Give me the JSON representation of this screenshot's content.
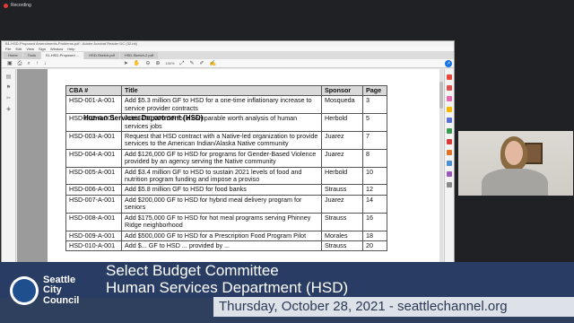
{
  "recording": {
    "label": "Recording"
  },
  "window": {
    "titlebar_text": "B1-HSD-Proposed Amendments-Problems.pdf - Adobe Acrobat Reader DC (32-bit)",
    "menu": [
      "File",
      "Edit",
      "View",
      "Sign",
      "Window",
      "Help"
    ],
    "tabs": [
      "Home",
      "Tools",
      "01-HSD-Proposed ...",
      "HSD-Sketch.pdf",
      "HSD-Sketch-2.pdf"
    ],
    "toolbar_icons": [
      "save-icon",
      "print-icon",
      "search-icon",
      "prev-page-icon",
      "next-page-icon",
      "select-icon",
      "hand-icon",
      "zoom-out-icon",
      "zoom-in-icon",
      "zoom-level",
      "fit-icon",
      "comment-icon",
      "highlight-icon",
      "sign-icon"
    ],
    "zoom": "150%"
  },
  "document": {
    "heading": "Human Services Department (HSD)",
    "table": {
      "headers": [
        "CBA #",
        "Title",
        "Sponsor",
        "Page"
      ],
      "rows": [
        [
          "HSD-001-A-001",
          "Add $5.3 million GF to HSD for a one-time inflationary increase to service provider contracts",
          "Mosqueda",
          "3"
        ],
        [
          "HSD-002-A-001",
          "Add $750,000 GF for a comparable worth analysis of human services jobs",
          "Herbold",
          "5"
        ],
        [
          "HSD-003-A-001",
          "Request that HSD contract with a Native-led organization to provide services to the American Indian/Alaska Native community",
          "Juarez",
          "7"
        ],
        [
          "HSD-004-A-001",
          "Add $126,000 GF to HSD for programs for Gender-Based Violence provided by an agency serving the Native community",
          "Juarez",
          "8"
        ],
        [
          "HSD-005-A-001",
          "Add $3.4 million GF to HSD to sustain 2021 levels of food and nutrition program funding and impose a proviso",
          "Herbold",
          "10"
        ],
        [
          "HSD-006-A-001",
          "Add $5.8 million GF to HSD for food banks",
          "Strauss",
          "12"
        ],
        [
          "HSD-007-A-001",
          "Add $200,000 GF to HSD for hybrid meal delivery program for seniors",
          "Juarez",
          "14"
        ],
        [
          "HSD-008-A-001",
          "Add $175,000 GF to HSD for hot meal programs serving Phinney Ridge neighborhood",
          "Strauss",
          "16"
        ],
        [
          "HSD-009-A-001",
          "Add $500,000 GF to HSD for a Prescription Food Program Pilot",
          "Morales",
          "18"
        ],
        [
          "HSD-010-A-001",
          "Add $... GF to HSD ... provided by ...",
          "Strauss",
          "20"
        ]
      ]
    }
  },
  "lower_third": {
    "logo_lines": [
      "Seattle",
      "City",
      "Council"
    ],
    "title": "Select Budget Committee",
    "subtitle": "Human Services Department (HSD)",
    "date_line": "Thursday, October 28, 2021 - seattlechannel.org"
  }
}
